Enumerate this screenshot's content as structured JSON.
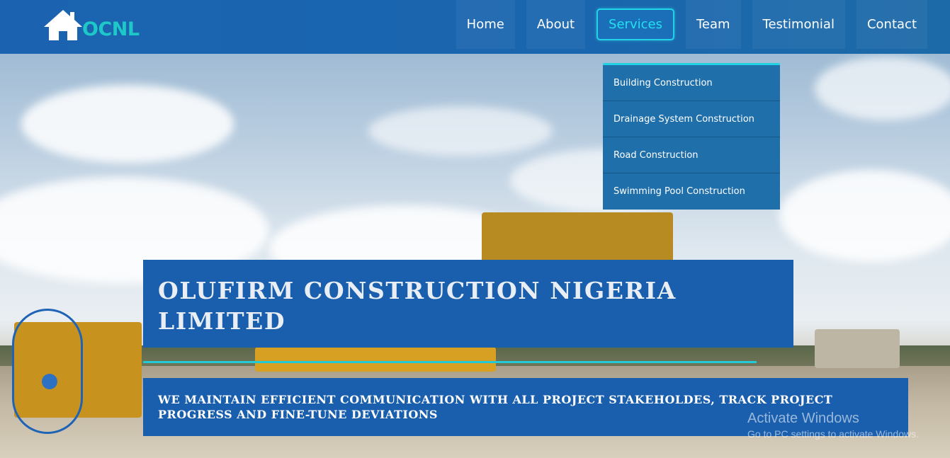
{
  "brand": {
    "logo_text": "OCNL",
    "logo_color": "#1ec8c8"
  },
  "nav": {
    "items": [
      {
        "label": "Home"
      },
      {
        "label": "About"
      },
      {
        "label": "Services",
        "active": true
      },
      {
        "label": "Team"
      },
      {
        "label": "Testimonial"
      },
      {
        "label": "Contact"
      }
    ]
  },
  "services_dropdown": {
    "items": [
      {
        "label": "Building Construction"
      },
      {
        "label": "Drainage System Construction"
      },
      {
        "label": "Road Construction"
      },
      {
        "label": "Swimming Pool Construction"
      }
    ]
  },
  "hero": {
    "title": "OLUFIRM CONSTRUCTION NIGERIA LIMITED",
    "subtitle": "WE MAINTAIN EFFICIENT COMMUNICATION WITH ALL PROJECT STAKEHOLDES, TRACK PROJECT PROGRESS AND FINE-TUNE DEVIATIONS"
  },
  "watermark": {
    "title": "Activate Windows",
    "subtitle": "Go to PC settings to activate Windows."
  },
  "colors": {
    "header_blue": "#1b63b0",
    "accent_cyan": "#22d3e6",
    "hero_box": "#1a5fae",
    "dropdown_bg": "#1f6fab"
  },
  "icons": {
    "logo": "house-icon"
  }
}
